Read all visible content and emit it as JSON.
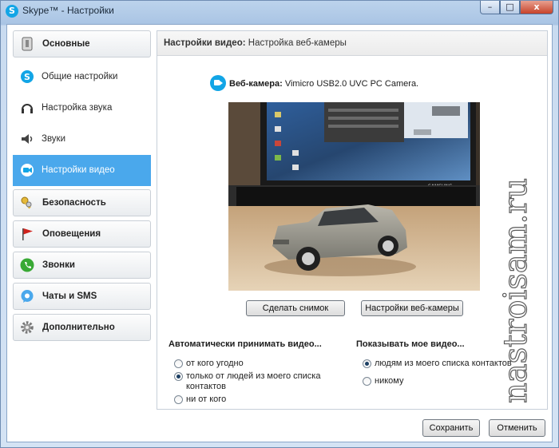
{
  "window": {
    "title": "Skype™ - Настройки",
    "minimize": "–",
    "maximize": "□",
    "close": "x"
  },
  "sidebar": {
    "categories": [
      {
        "label": "Основные",
        "icon": "general-icon"
      },
      {
        "label": "Безопасность",
        "icon": "keys-icon"
      },
      {
        "label": "Оповещения",
        "icon": "flag-icon"
      },
      {
        "label": "Звонки",
        "icon": "phone-icon"
      },
      {
        "label": "Чаты и SMS",
        "icon": "chat-icon"
      },
      {
        "label": "Дополнительно",
        "icon": "gear-icon"
      }
    ],
    "subitems": [
      {
        "label": "Общие настройки",
        "icon": "skype-icon"
      },
      {
        "label": "Настройка звука",
        "icon": "headset-icon"
      },
      {
        "label": "Звуки",
        "icon": "speaker-icon"
      },
      {
        "label": "Настройки видео",
        "icon": "video-camera-icon",
        "active": true
      }
    ]
  },
  "panel": {
    "header_bold": "Настройки видео:",
    "header_rest": "Настройка веб-камеры",
    "webcam_label": "Веб-камера:",
    "webcam_name": "Vimicro USB2.0 UVC PC Camera.",
    "preview_monitor_brand": "SAMSUNG",
    "snapshot_button": "Сделать снимок",
    "webcam_settings_button": "Настройки веб-камеры",
    "auto_accept": {
      "title": "Автоматически принимать видео...",
      "options": [
        "от кого угодно",
        "только от людей из моего списка",
        "контактов",
        "ни от кого"
      ],
      "selected": 1
    },
    "show_my_video": {
      "title": "Показывать мое видео...",
      "options": [
        "людям из моего списка контактов",
        "никому"
      ],
      "selected": 0
    }
  },
  "footer": {
    "save": "Сохранить",
    "cancel": "Отменить"
  },
  "watermark": "nastroisam.ru",
  "colors": {
    "accent": "#4aa8ec",
    "skype_blue": "#12a5e6"
  }
}
